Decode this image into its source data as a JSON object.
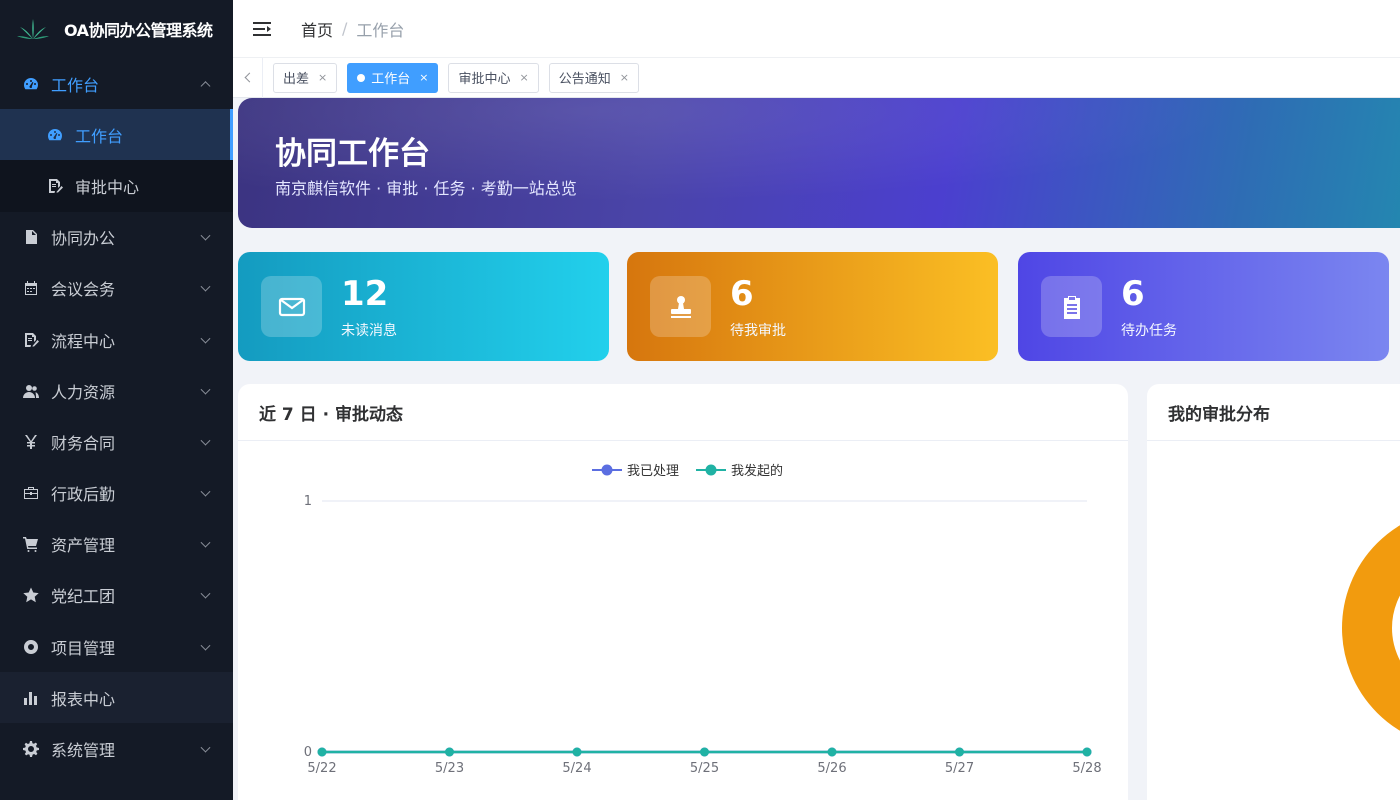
{
  "app": {
    "title": "OA协同办公管理系统"
  },
  "sidebar": {
    "items": [
      {
        "label": "工作台",
        "icon": "dashboard-icon",
        "expanded": true,
        "children": [
          {
            "label": "工作台",
            "icon": "dashboard-icon",
            "selected": true
          },
          {
            "label": "审批中心",
            "icon": "document-edit-icon"
          }
        ]
      },
      {
        "label": "协同办公",
        "icon": "document-icon"
      },
      {
        "label": "会议会务",
        "icon": "calendar-icon"
      },
      {
        "label": "流程中心",
        "icon": "document-edit-icon"
      },
      {
        "label": "人力资源",
        "icon": "users-icon"
      },
      {
        "label": "财务合同",
        "icon": "yen-icon"
      },
      {
        "label": "行政后勤",
        "icon": "briefcase-icon"
      },
      {
        "label": "资产管理",
        "icon": "cart-icon"
      },
      {
        "label": "党纪工团",
        "icon": "star-icon"
      },
      {
        "label": "项目管理",
        "icon": "lifebuoy-icon"
      },
      {
        "label": "报表中心",
        "icon": "bar-chart-icon"
      },
      {
        "label": "系统管理",
        "icon": "gear-icon"
      }
    ]
  },
  "header": {
    "breadcrumb": {
      "home": "首页",
      "separator": "/",
      "current": "工作台"
    }
  },
  "tags": [
    {
      "label": "出差",
      "close": "×"
    },
    {
      "label": "工作台",
      "close": "×",
      "active": true
    },
    {
      "label": "审批中心",
      "close": "×"
    },
    {
      "label": "公告通知",
      "close": "×"
    }
  ],
  "hero": {
    "title": "协同工作台",
    "subtitle": "南京麒信软件 · 审批 · 任务 · 考勤一站总览"
  },
  "stats": [
    {
      "value": "12",
      "label": "未读消息",
      "icon": "mail-icon"
    },
    {
      "value": "6",
      "label": "待我审批",
      "icon": "stamp-icon"
    },
    {
      "value": "6",
      "label": "待办任务",
      "icon": "clipboard-icon"
    }
  ],
  "cards": {
    "activity_title": "近 7 日 · 审批动态",
    "distribution_title": "我的审批分布"
  },
  "colors": {
    "primary": "#409eff",
    "series_processed": "#5b6ee1",
    "series_initiated": "#20b2a4",
    "donut": "#f29b0e"
  },
  "chart_data": [
    {
      "type": "line",
      "categories": [
        "5/22",
        "5/23",
        "5/24",
        "5/25",
        "5/26",
        "5/27",
        "5/28"
      ],
      "series": [
        {
          "name": "我已处理",
          "values": [
            0,
            0,
            0,
            0,
            0,
            0,
            0
          ]
        },
        {
          "name": "我发起的",
          "values": [
            0,
            0,
            0,
            0,
            0,
            0,
            0
          ]
        }
      ],
      "yticks": [
        "0",
        "1"
      ],
      "ylim": [
        0,
        1
      ],
      "legend": "top-center",
      "grid": true
    },
    {
      "type": "pie",
      "style": "donut",
      "values": [
        1
      ]
    }
  ]
}
